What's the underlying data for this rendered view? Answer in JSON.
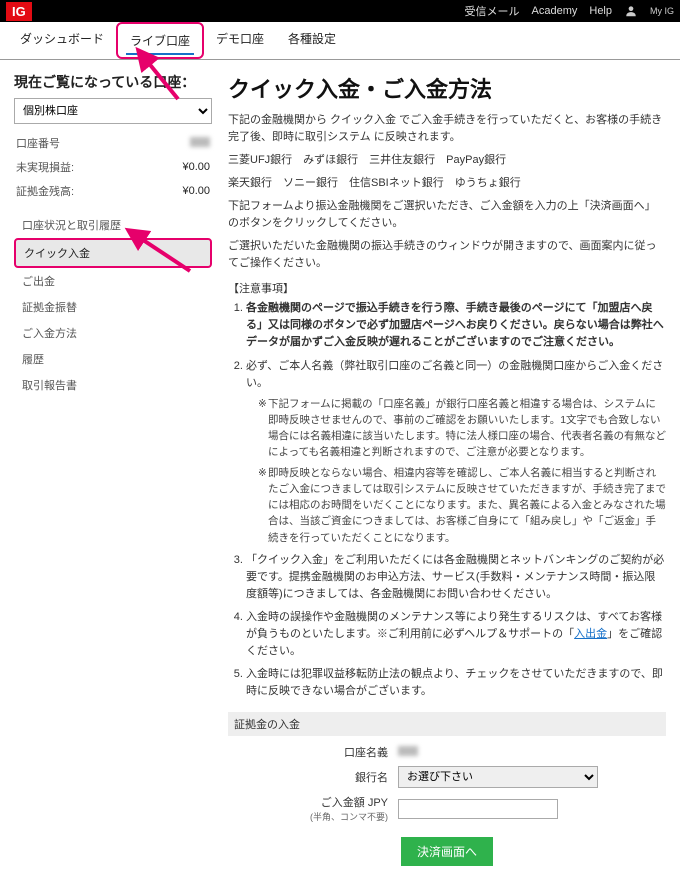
{
  "topbar": {
    "brand": "IG",
    "links": [
      "受信メール",
      "Academy",
      "Help"
    ],
    "my": "My IG"
  },
  "tabs": {
    "items": [
      "ダッシュボード",
      "ライブ口座",
      "デモ口座",
      "各種設定"
    ],
    "active_index": 1
  },
  "sidebar": {
    "title": "現在ご覧になっている口座：",
    "account_select": "個別株口座",
    "summary": [
      {
        "label": "口座番号",
        "value": ""
      },
      {
        "label": "未実現損益:",
        "value": "¥0.00"
      },
      {
        "label": "証拠金残高:",
        "value": "¥0.00"
      }
    ],
    "nav": [
      "口座状況と取引履歴",
      "クイック入金",
      "ご出金",
      "証拠金振替",
      "ご入金方法",
      "履歴",
      "取引報告書"
    ],
    "nav_highlight_index": 1
  },
  "main": {
    "title": "クイック入金・ご入金方法",
    "intro1": "下記の金融機関から クイック入金 でご入金手続きを行っていただくと、お客様の手続き完了後、即時に取引システム に反映されます。",
    "banks_line1": "三菱UFJ銀行　みずほ銀行　三井住友銀行　PayPay銀行",
    "banks_line2": "楽天銀行　ソニー銀行　住信SBIネット銀行　ゆうちょ銀行",
    "intro2": "下記フォームより振込金融機関をご選択いただき、ご入金額を入力の上「決済画面へ」のボタンをクリックしてください。",
    "intro3": "ご選択いただいた金融機関の振込手続きのウィンドウが開きますので、画面案内に従ってご操作ください。",
    "notice_header": "【注意事項】",
    "notices": [
      {
        "text_bold": "各金融機関のページで振込手続きを行う際、手続き最後のページにて「加盟店へ戻る」又は同様のボタンで必ず加盟店ページへお戻りください。戻らない場合は弊社へデータが届かずご入金反映が遅れることがございますのでご注意ください。"
      },
      {
        "text": "必ず、ご本人名義（弊社取引口座のご名義と同一）の金融機関口座からご入金ください。",
        "subs": [
          "下記フォームに掲載の「口座名義」が銀行口座名義と相違する場合は、システムに即時反映させませんので、事前のご確認をお願いいたします。1文字でも合致しない場合には名義相違に該当いたします。特に法人様口座の場合、代表者名義の有無などによっても名義相違と判断されますので、ご注意が必要となります。",
          "即時反映とならない場合、相違内容等を確認し、ご本人名義に相当すると判断されたご入金につきましては取引システムに反映させていただきますが、手続き完了までには相応のお時間をいだくことになります。また、異名義による入金とみなされた場合は、当該ご資金につきましては、お客様ご自身にて「組み戻し」や「ご返金」手続きを行っていただくことになります。"
        ]
      },
      {
        "text": "「クイック入金」をご利用いただくには各金融機関とネットバンキングのご契約が必要です。提携金融機関のお申込方法、サービス(手数料・メンテナンス時間・振込限度額等)につきましては、各金融機関にお問い合わせください。"
      },
      {
        "text_pre": "入金時の誤操作や金融機関のメンテナンス等により発生するリスクは、すべてお客様が負うものといたします。※ご利用前に必ずヘルプ＆サポートの「",
        "link_label": "入出金",
        "text_post": "」をご確認ください。"
      },
      {
        "text": "入金時には犯罪収益移転防止法の観点より、チェックをさせていただきますので、即時に反映できない場合がございます。"
      }
    ],
    "deposit": {
      "section_title": "証拠金の入金",
      "name_label": "口座名義",
      "bank_label": "銀行名",
      "bank_placeholder": "お選び下さい",
      "amount_label": "ご入金額 JPY",
      "amount_hint": "(半角、コンマ不要)",
      "submit": "決済画面へ"
    }
  }
}
